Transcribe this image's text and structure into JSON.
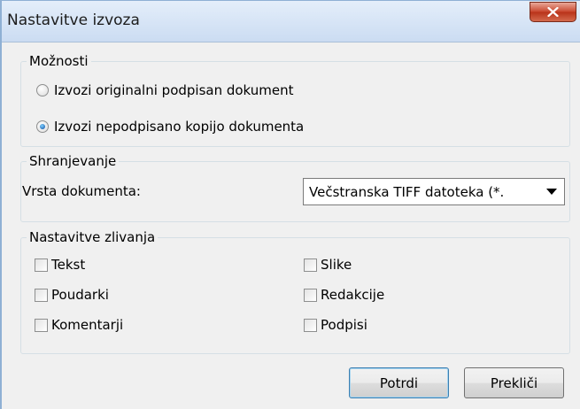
{
  "window": {
    "title": "Nastavitve izvoza",
    "close_label": "x"
  },
  "options": {
    "title": "Možnosti",
    "radios": [
      {
        "label": "Izvozi originalni podpisan dokument",
        "checked": false
      },
      {
        "label": "Izvozi nepodpisano kopijo dokumenta",
        "checked": true
      }
    ]
  },
  "saving": {
    "title": "Shranjevanje",
    "doc_type_label": "Vrsta dokumenta:",
    "doc_type_value": "Večstranska TIFF datoteka (*."
  },
  "merge": {
    "title": "Nastavitve zlivanja",
    "left": [
      "Tekst",
      "Poudarki",
      "Komentarji"
    ],
    "right": [
      "Slike",
      "Redakcije",
      "Podpisi"
    ]
  },
  "buttons": {
    "confirm": "Potrdi",
    "cancel": "Prekliči"
  },
  "colors": {
    "title_bar": "#cbdcf2",
    "close_button": "#c9462c",
    "dialog_bg": "#f0f0f0"
  }
}
